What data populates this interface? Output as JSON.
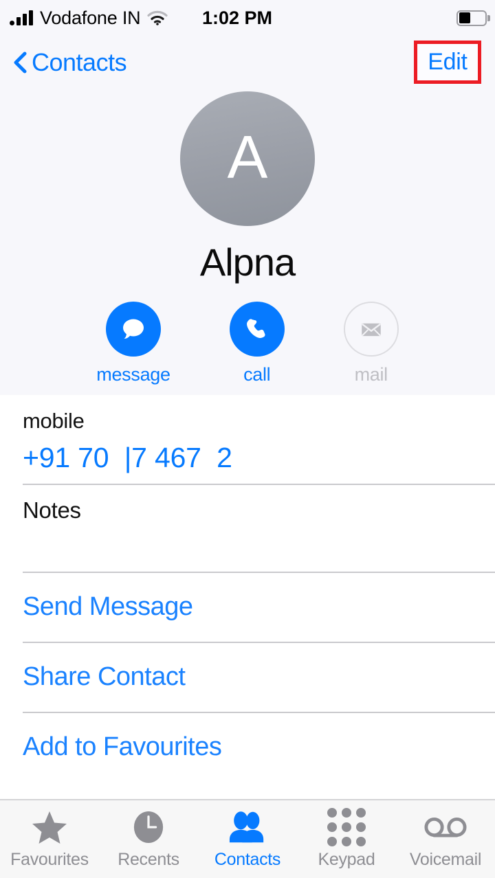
{
  "statusbar": {
    "carrier": "Vodafone IN",
    "time": "1:02 PM",
    "signal_icon": "signal-bars-icon",
    "wifi_icon": "wifi-icon",
    "battery_icon": "battery-icon",
    "battery_level_percent": 38
  },
  "navbar": {
    "back_label": "Contacts",
    "back_icon": "chevron-left-icon",
    "edit_label": "Edit",
    "highlight_color": "#ec1c24"
  },
  "contact": {
    "avatar_letter": "A",
    "name": "Alpna"
  },
  "actions": [
    {
      "label": "message",
      "icon": "message-bubble-icon",
      "enabled": true
    },
    {
      "label": "call",
      "icon": "phone-handset-icon",
      "enabled": true
    },
    {
      "label": "mail",
      "icon": "envelope-icon",
      "enabled": false
    }
  ],
  "fields": {
    "phone_label": "mobile",
    "phone_number": "+91 70  |7 467  2",
    "notes_label": "Notes",
    "notes_value": ""
  },
  "list_actions": [
    {
      "label": "Send Message"
    },
    {
      "label": "Share Contact"
    },
    {
      "label": "Add to Favourites"
    }
  ],
  "tabs": [
    {
      "label": "Favourites",
      "icon": "star-icon",
      "active": false
    },
    {
      "label": "Recents",
      "icon": "clock-icon",
      "active": false
    },
    {
      "label": "Contacts",
      "icon": "people-icon",
      "active": true
    },
    {
      "label": "Keypad",
      "icon": "keypad-dots-icon",
      "active": false
    },
    {
      "label": "Voicemail",
      "icon": "voicemail-icon",
      "active": false
    }
  ],
  "colors": {
    "accent": "#067aff",
    "header_bg": "#f7f7fb",
    "inactive": "#8e8e93"
  }
}
